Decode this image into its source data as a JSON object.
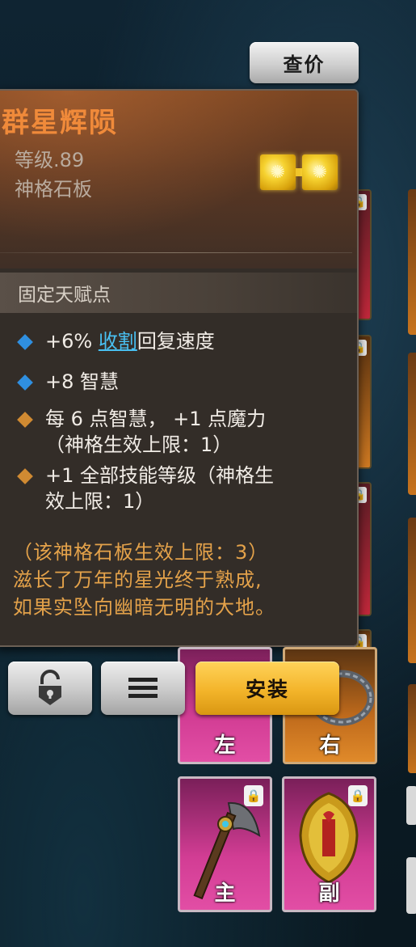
{
  "price_button": {
    "label": "查价"
  },
  "item": {
    "name": "群星辉陨",
    "level": "等级.89",
    "type": "神格石板"
  },
  "section": {
    "title": "固定天赋点"
  },
  "affixes": [
    {
      "bullet": "blue",
      "prefix": "+6% ",
      "link": "收割",
      "suffix": "回复速度"
    },
    {
      "bullet": "blue",
      "text": "+8 智慧"
    },
    {
      "bullet": "orange",
      "line1": "每 6 点智慧， +1 点魔力",
      "line2": "（神格生效上限：1）"
    },
    {
      "bullet": "orange",
      "line1": "+1 全部技能等级（神格生",
      "line2": "效上限：1）"
    }
  ],
  "description": {
    "line1": "（该神格石板生效上限：3）",
    "line2": "滋长了万年的星光终于熟成,",
    "line3": "如果实坠向幽暗无明的大地。"
  },
  "buttons": {
    "lock_icon": "padlock-open-icon",
    "menu_icon": "menu-lines-icon",
    "install_label": "安装"
  },
  "equipment_slots": {
    "left": {
      "label": "左"
    },
    "right": {
      "label": "右"
    },
    "main": {
      "label": "主",
      "icon": "axe-icon"
    },
    "off": {
      "label": "副",
      "icon": "shield-icon"
    }
  },
  "colors": {
    "item_name": "#f08a3a",
    "link": "#49c0f2",
    "description": "#e4a24a",
    "install_button": "#f3b42a",
    "bullet_blue": "#2f8fe0",
    "bullet_orange": "#d08a32"
  }
}
